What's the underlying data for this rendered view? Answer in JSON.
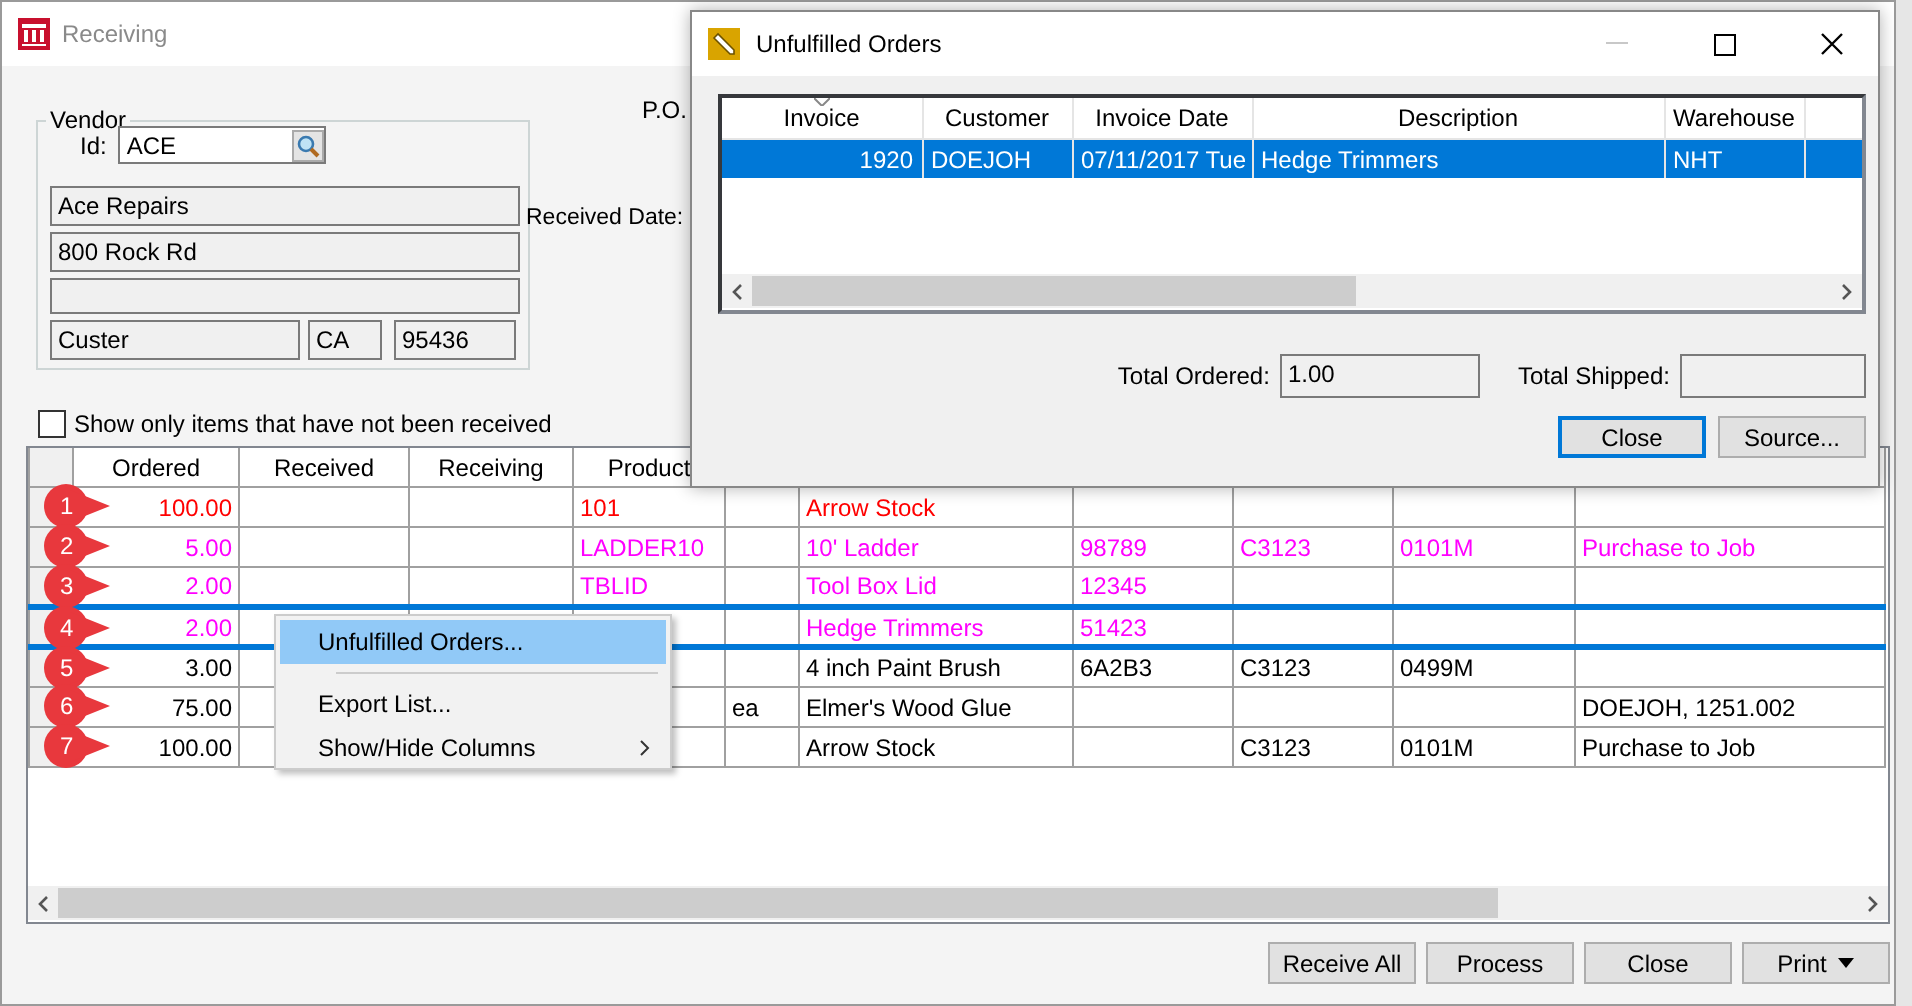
{
  "window": {
    "title": "Receiving"
  },
  "vendor": {
    "legend": "Vendor",
    "id_label": "Id:",
    "id": "ACE",
    "name": "Ace Repairs",
    "address_1": "800 Rock Rd",
    "city": "Custer",
    "state": "CA",
    "zip": "95436"
  },
  "po_label": "P.O.",
  "received_date_label": "Received Date:",
  "filter": {
    "label": "Show only items that have not been received",
    "checked": false
  },
  "grid": {
    "columns": [
      "Ordered",
      "Received",
      "Receiving",
      "Product"
    ],
    "rows": [
      {
        "callout": "1",
        "selected": false,
        "color": "#ff0000",
        "ordered": "100.00",
        "product": "101",
        "description": "Arrow Stock"
      },
      {
        "callout": "2",
        "selected": false,
        "color": "#ff00ff",
        "ordered": "5.00",
        "product": "LADDER10",
        "description": "10' Ladder",
        "column_7": "98789",
        "column_8": "C3123",
        "column_9": "0101M",
        "column_10": "Purchase to Job"
      },
      {
        "callout": "3",
        "selected": false,
        "color": "#ff00ff",
        "ordered": "2.00",
        "product": "TBLID",
        "description": "Tool Box Lid",
        "column_7": "12345"
      },
      {
        "callout": "4",
        "selected": true,
        "color": "#ff00ff",
        "ordered": "2.00",
        "description": "Hedge Trimmers",
        "column_7": "51423"
      },
      {
        "callout": "5",
        "selected": false,
        "color": "#000000",
        "ordered": "3.00",
        "description": "4 inch Paint Brush",
        "column_7": "6A2B3",
        "column_8": "C3123",
        "column_9": "0499M"
      },
      {
        "callout": "6",
        "selected": false,
        "color": "#000000",
        "ordered": "75.00",
        "unit": "ea",
        "description": "Elmer's Wood Glue",
        "column_10": "DOEJOH, 1251.002"
      },
      {
        "callout": "7",
        "selected": false,
        "color": "#000000",
        "ordered": "100.00",
        "description": "Arrow Stock",
        "column_8": "C3123",
        "column_9": "0101M",
        "column_10": "Purchase to Job"
      }
    ]
  },
  "buttons": [
    {
      "label": "Receive All",
      "dropdown": false
    },
    {
      "label": "Process",
      "dropdown": false
    },
    {
      "label": "Close",
      "dropdown": false
    },
    {
      "label": "Print",
      "dropdown": true
    }
  ],
  "context_menu": {
    "items": [
      {
        "label": "Unfulfilled Orders...",
        "selected": true,
        "submenu": false,
        "separator_after": true
      },
      {
        "label": "Export List...",
        "selected": false,
        "submenu": false,
        "separator_after": false
      },
      {
        "label": "Show/Hide Columns",
        "selected": false,
        "submenu": true,
        "separator_after": false
      }
    ]
  },
  "dialog": {
    "title": "Unfulfilled Orders",
    "columns": [
      "Invoice",
      "Customer",
      "Invoice Date",
      "Description",
      "Warehouse"
    ],
    "rows": [
      {
        "selected": true,
        "cells": [
          "1920",
          "DOEJOH",
          "07/11/2017 Tue",
          "Hedge Trimmers",
          "NHT"
        ]
      }
    ],
    "total_ordered_label": "Total Ordered:",
    "total_ordered": "1.00",
    "total_shipped_label": "Total Shipped:",
    "buttons": [
      {
        "label": "Close",
        "focused": true
      },
      {
        "label": "Source...",
        "focused": false
      }
    ]
  }
}
